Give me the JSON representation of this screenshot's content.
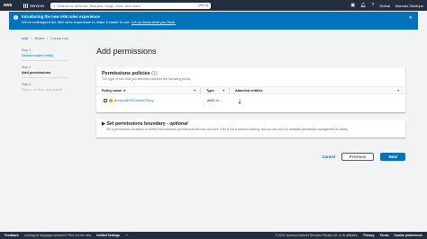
{
  "nav": {
    "logo": "aws",
    "services": "Services",
    "search_placeholder": "Search for services, features, blogs, docs, and more",
    "search_shortcut": "[Alt+S]",
    "region": "Global",
    "account": "Mannan Siddique"
  },
  "flash": {
    "title": "Introducing the new IAM roles experience",
    "message": "We've redesigned the IAM roles experience to make it easier to use.",
    "link": "Let us know what you think."
  },
  "breadcrumb": {
    "item1": "IAM",
    "item2": "Roles",
    "item3": "Create role"
  },
  "steps": [
    {
      "kicker": "Step 1",
      "label": "Select trusted entity"
    },
    {
      "kicker": "Step 2",
      "label": "Add permissions"
    },
    {
      "kicker": "Step 3",
      "label": "Name, review, and create"
    }
  ],
  "page_title": "Add permissions",
  "policies": {
    "title": "Permissions policies",
    "count": "(1)",
    "description": "The type of role that you selected requires the following policy.",
    "columns": {
      "name": "Policy name",
      "type": "Type",
      "attached": "Attached entities"
    },
    "rows": [
      {
        "name": "AmazonEKSClusterPolicy",
        "type": "AWS m...",
        "attached": "1"
      }
    ]
  },
  "boundary": {
    "title": "Set permissions boundary -",
    "optional": "optional",
    "description": "Set a permissions boundary to control the maximum permissions this role can have. This is not a common setting, but you can use it to delegate permission management to others."
  },
  "actions": {
    "cancel": "Cancel",
    "previous": "Previous",
    "next": "Next"
  },
  "footer": {
    "feedback": "Feedback",
    "language_text": "Looking for language selection? Find it in the new",
    "unified_settings": "Unified Settings",
    "copyright": "© 2022, Amazon Internet Services Private Ltd. or its affiliates.",
    "privacy": "Privacy",
    "terms": "Terms",
    "cookie": "Cookie preferences"
  }
}
